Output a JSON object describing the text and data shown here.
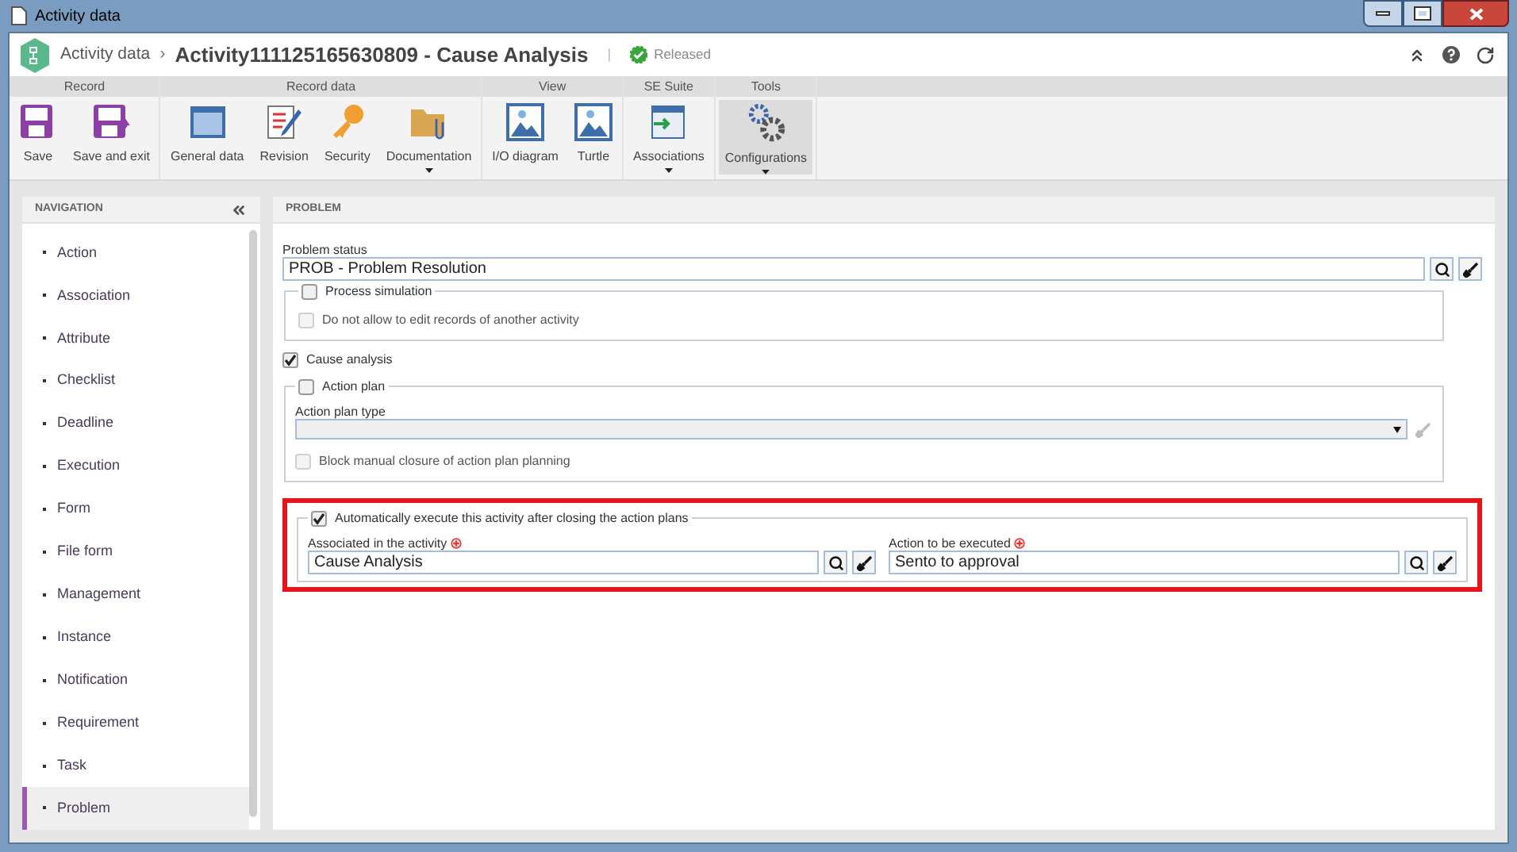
{
  "window": {
    "title": "Activity data"
  },
  "header": {
    "breadcrumb": "Activity data",
    "separator": "›",
    "title": "Activity111125165630809 - Cause Analysis",
    "divider": "|",
    "status": "Released"
  },
  "ribbon": {
    "groups": [
      {
        "label": "Record",
        "buttons": [
          {
            "label": "Save",
            "kind": "save",
            "dropdown": false,
            "selected": false
          },
          {
            "label": "Save and exit",
            "kind": "save-exit",
            "dropdown": false,
            "selected": false
          }
        ]
      },
      {
        "label": "Record data",
        "buttons": [
          {
            "label": "General data",
            "kind": "window",
            "dropdown": false,
            "selected": false
          },
          {
            "label": "Revision",
            "kind": "revision",
            "dropdown": false,
            "selected": false
          },
          {
            "label": "Security",
            "kind": "key",
            "dropdown": false,
            "selected": false
          },
          {
            "label": "Documentation",
            "kind": "folder",
            "dropdown": true,
            "selected": false
          }
        ]
      },
      {
        "label": "View",
        "buttons": [
          {
            "label": "I/O diagram",
            "kind": "image",
            "dropdown": false,
            "selected": false
          },
          {
            "label": "Turtle",
            "kind": "image",
            "dropdown": false,
            "selected": false
          }
        ]
      },
      {
        "label": "SE Suite",
        "buttons": [
          {
            "label": "Associations",
            "kind": "import",
            "dropdown": true,
            "selected": false
          }
        ]
      },
      {
        "label": "Tools",
        "buttons": [
          {
            "label": "Configurations",
            "kind": "gears",
            "dropdown": true,
            "selected": true
          }
        ]
      }
    ]
  },
  "navigation": {
    "title": "NAVIGATION",
    "items": [
      {
        "label": "Action",
        "selected": false
      },
      {
        "label": "Association",
        "selected": false
      },
      {
        "label": "Attribute",
        "selected": false
      },
      {
        "label": "Checklist",
        "selected": false
      },
      {
        "label": "Deadline",
        "selected": false
      },
      {
        "label": "Execution",
        "selected": false
      },
      {
        "label": "Form",
        "selected": false
      },
      {
        "label": "File form",
        "selected": false
      },
      {
        "label": "Management",
        "selected": false
      },
      {
        "label": "Instance",
        "selected": false
      },
      {
        "label": "Notification",
        "selected": false
      },
      {
        "label": "Requirement",
        "selected": false
      },
      {
        "label": "Task",
        "selected": false
      },
      {
        "label": "Problem",
        "selected": true
      }
    ]
  },
  "panel": {
    "title": "PROBLEM",
    "problem_status": {
      "label": "Problem status",
      "value": "PROB - Problem Resolution"
    },
    "process_simulation": {
      "label": "Process simulation",
      "checked": false,
      "option": {
        "label": "Do not allow to edit records of another activity",
        "checked": false,
        "disabled": true
      }
    },
    "cause_analysis": {
      "label": "Cause analysis",
      "checked": true
    },
    "action_plan": {
      "label": "Action plan",
      "checked": false,
      "type_field": {
        "label": "Action plan type",
        "disabled": true
      },
      "option": {
        "label": "Block manual closure of action plan planning",
        "checked": false,
        "disabled": true
      }
    },
    "auto_execute": {
      "label": "Automatically execute this activity after closing the action plans",
      "checked": true,
      "highlighted": true,
      "fields": [
        {
          "label": "Associated in the activity",
          "required": true,
          "value": "Cause Analysis"
        },
        {
          "label": "Action to be executed",
          "required": true,
          "value": "Sento to approval"
        }
      ]
    }
  }
}
